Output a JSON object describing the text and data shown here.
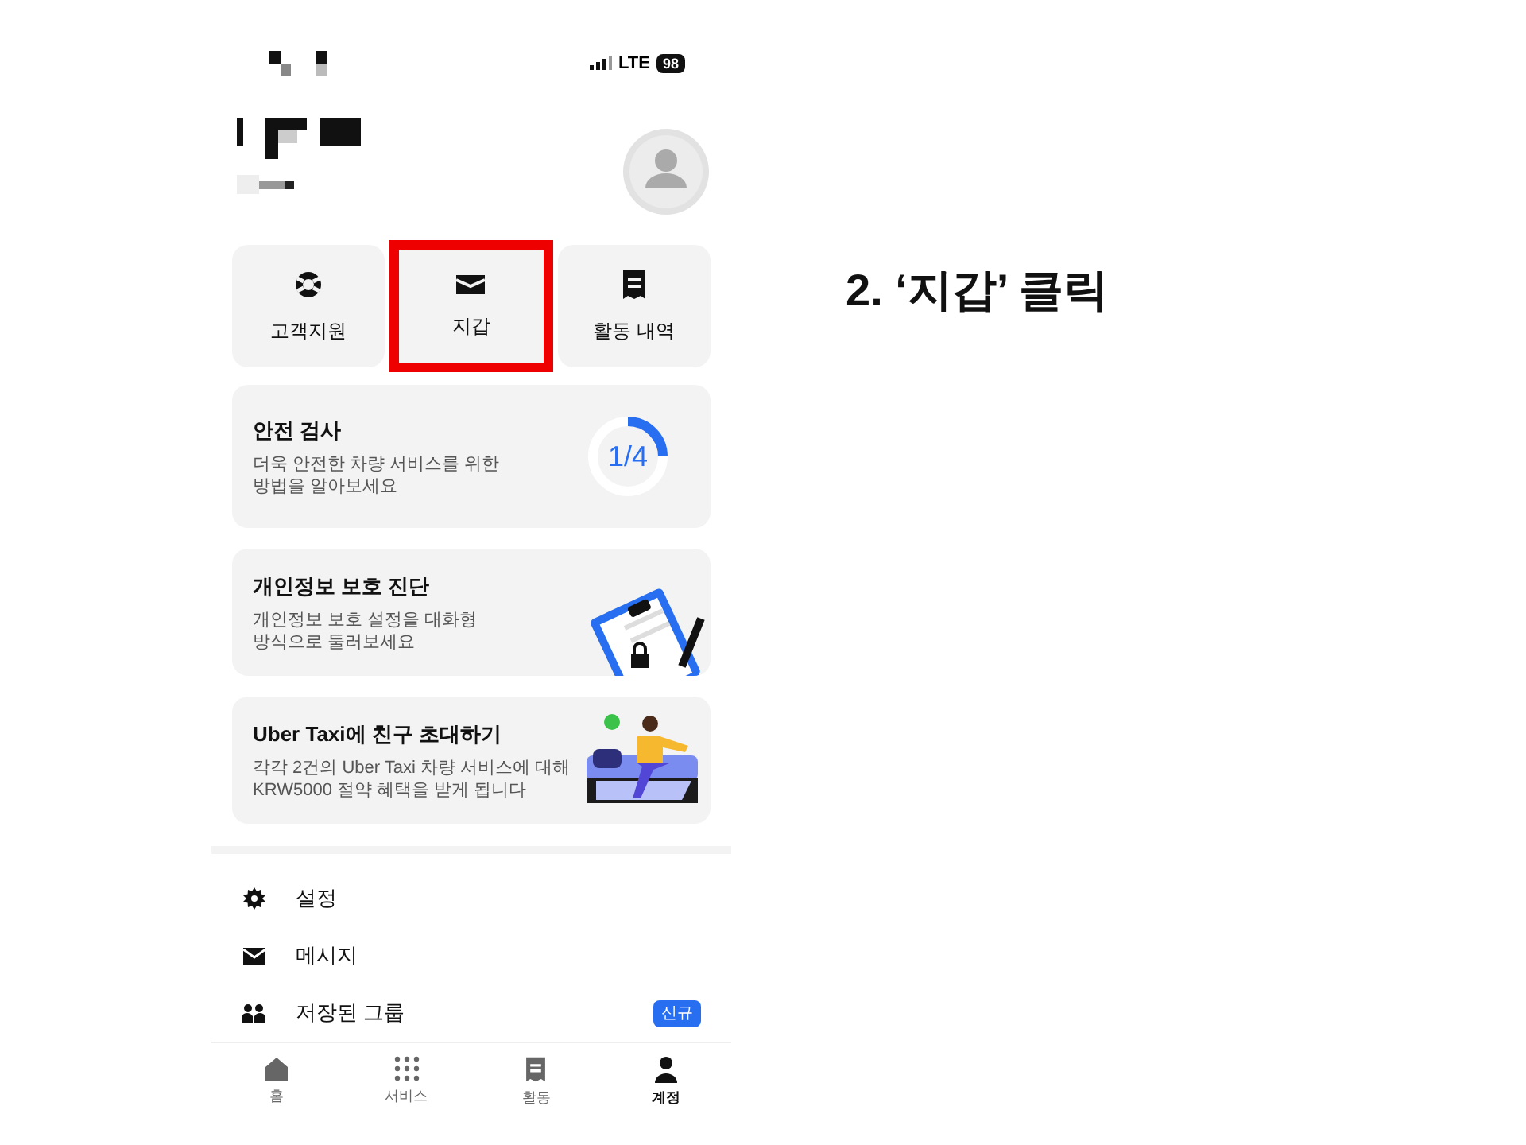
{
  "status_bar": {
    "network": "LTE",
    "battery": "98"
  },
  "quick_actions": [
    {
      "label": "고객지원",
      "highlighted": false
    },
    {
      "label": "지갑",
      "highlighted": true
    },
    {
      "label": "활동 내역",
      "highlighted": false
    }
  ],
  "cards": [
    {
      "kind": "progress",
      "title": "안전 검사",
      "description": "더욱 안전한 차량 서비스를 위한\n방법을 알아보세요",
      "progress_label": "1/4",
      "level": 0.25
    },
    {
      "kind": "clipboard",
      "title": "개인정보 보호 진단",
      "description": "개인정보 보호 설정을 대화형\n방식으로 둘러보세요"
    },
    {
      "kind": "invite",
      "title": "Uber Taxi에 친구 초대하기",
      "description": "각각 2건의 Uber Taxi 차량 서비스에 대해\nKRW5000 절약 혜택을 받게 됩니다"
    }
  ],
  "menu": [
    {
      "label": "설정"
    },
    {
      "label": "메시지"
    },
    {
      "label": "저장된 그룹",
      "badge": "신규"
    }
  ],
  "tab_bar": [
    {
      "label": "홈",
      "selected": false
    },
    {
      "label": "서비스",
      "selected": false
    },
    {
      "label": "활동",
      "selected": false
    },
    {
      "label": "계정",
      "selected": true
    }
  ],
  "annotation": "2. ‘지갑’ 클릭"
}
